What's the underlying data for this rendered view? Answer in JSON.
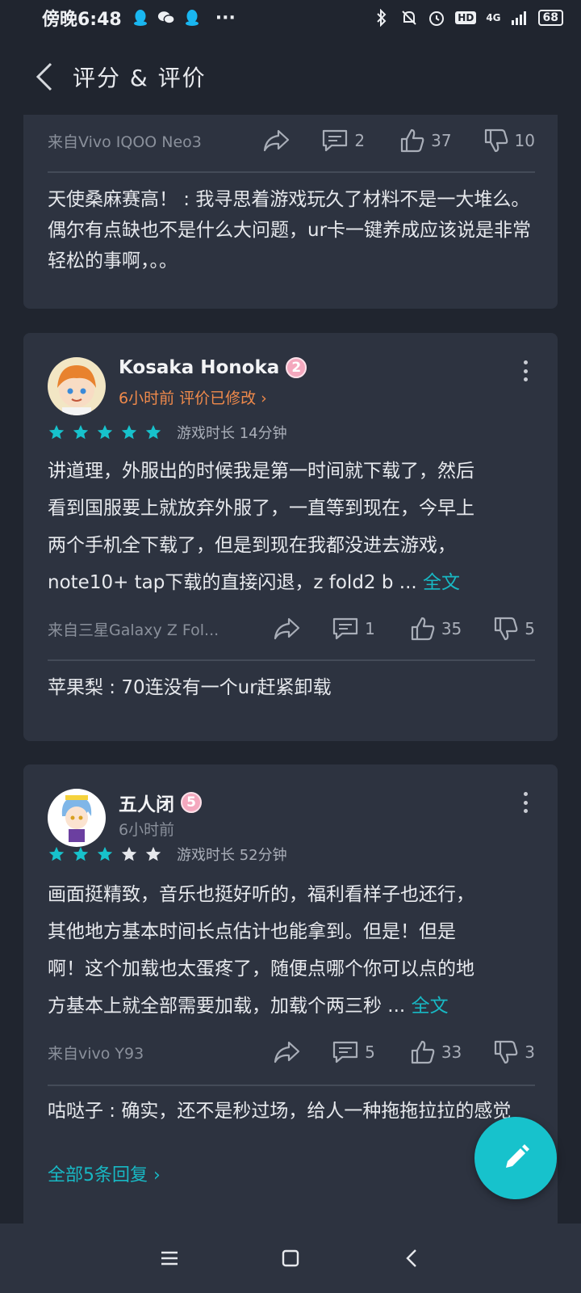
{
  "status_bar": {
    "time": "傍晚6:48",
    "more_dots": "···",
    "network": "4G",
    "hd": "HD",
    "battery": "68"
  },
  "header": {
    "title": "评分 & 评价"
  },
  "review_partial": {
    "device": "来自Vivo IQOO Neo3",
    "comments": "2",
    "likes": "37",
    "dislikes": "10",
    "reply": "天使桑麻赛高！ : 我寻思着游戏玩久了材料不是一大堆么。偶尔有点缺也不是什么大问题，ur卡一键养成应该说是非常轻松的事啊，。。"
  },
  "reviews": [
    {
      "username": "Kosaka Honoka",
      "level": "2",
      "meta": "6小时前  评价已修改 ›",
      "rating": 5,
      "play_time": "游戏时长 14分钟",
      "lines": [
        "讲道理，外服出的时候我是第一时间就下载了，然后",
        "看到国服要上就放弃外服了，一直等到现在，今早上",
        "两个手机全下载了，但是到现在我都没进去游戏，",
        "note10+ tap下载的直接闪退，z fold2 b ... "
      ],
      "full_link": "全文",
      "device": "来自三星Galaxy Z Fol...",
      "comments": "1",
      "likes": "35",
      "dislikes": "5",
      "reply": "苹果梨 : 70连没有一个ur赶紧卸载"
    },
    {
      "username": "五人闭",
      "level": "5",
      "meta": "6小时前",
      "rating": 3,
      "play_time": "游戏时长 52分钟",
      "lines": [
        "画面挺精致，音乐也挺好听的，福利看样子也还行，",
        "其他地方基本时间长点估计也能拿到。但是！但是",
        "啊！这个加载也太蛋疼了，随便点哪个你可以点的地",
        "方基本上就全部需要加载，加载个两三秒 ... "
      ],
      "full_link": "全文",
      "device": "来自vivo Y93",
      "comments": "5",
      "likes": "33",
      "dislikes": "3",
      "reply": "咕哒子 : 确实，还不是秒过场，给人一种拖拖拉拉的感觉",
      "more_replies": "全部5条回复 ›"
    }
  ],
  "colors": {
    "accent": "#17c2cc",
    "orange": "#f08a4b",
    "card": "#2d3340",
    "bg": "#20252f"
  }
}
